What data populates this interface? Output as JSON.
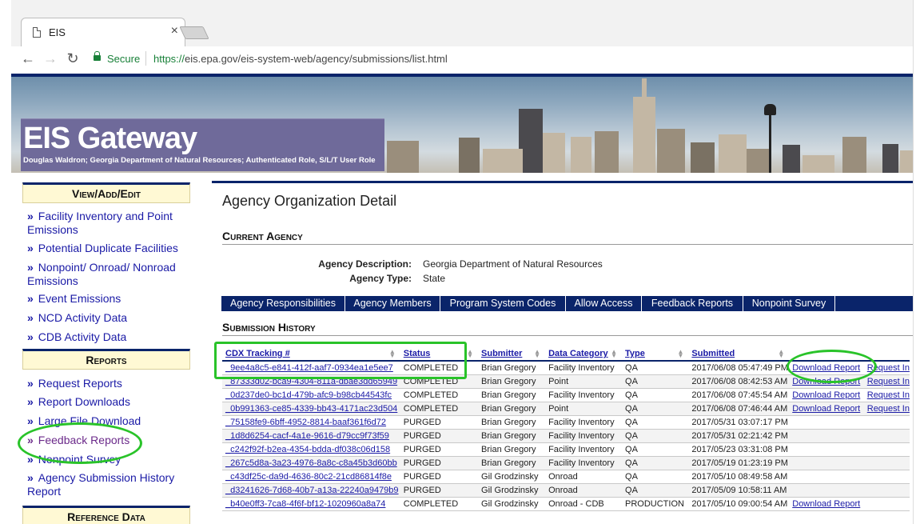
{
  "browser": {
    "tab_title": "EIS",
    "tab_close": "×",
    "secure_label": "Secure",
    "url_scheme": "https://",
    "url_rest": "eis.epa.gov/eis-system-web/agency/submissions/list.html",
    "back": "←",
    "forward": "→",
    "reload": "↻"
  },
  "banner": {
    "title": "EIS Gateway",
    "subtitle": "Douglas Waldron; Georgia Department of Natural Resources; Authenticated Role, S/L/T User Role"
  },
  "sidebar": {
    "view_head": "View/Add/Edit",
    "view_items": [
      {
        "label": "Facility Inventory and Point Emissions"
      },
      {
        "label": "Potential Duplicate Facilities"
      },
      {
        "label": "Nonpoint/ Onroad/ Nonroad Emissions"
      },
      {
        "label": "Event Emissions"
      },
      {
        "label": "NCD Activity Data"
      },
      {
        "label": "CDB Activity Data"
      }
    ],
    "reports_head": "Reports",
    "report_items": [
      {
        "label": "Request Reports"
      },
      {
        "label": "Report Downloads"
      },
      {
        "label": "Large File Download"
      },
      {
        "label": "Feedback Reports"
      },
      {
        "label": "Nonpoint Survey"
      },
      {
        "label": "Agency Submission History Report"
      }
    ],
    "bottom_head": "Reference Data",
    "bullet": "»"
  },
  "main": {
    "title": "Agency Organization Detail",
    "current_agency_head": "Current Agency",
    "agency_description_label": "Agency Description:",
    "agency_description": "Georgia Department of Natural Resources",
    "agency_type_label": "Agency Type:",
    "agency_type": "State",
    "tabs": [
      {
        "label": "Agency Responsibilities"
      },
      {
        "label": "Agency Members"
      },
      {
        "label": "Program System Codes"
      },
      {
        "label": "Allow Access"
      },
      {
        "label": "Feedback Reports"
      },
      {
        "label": "Nonpoint Survey"
      }
    ],
    "submission_head": "Submission History",
    "columns": [
      "CDX Tracking #",
      "Status",
      "Submitter",
      "Data Category",
      "Type",
      "Submitted",
      "",
      ""
    ],
    "rows": [
      [
        "_9ee4a8c5-e841-412f-aaf7-0934ea1e5ee7",
        "COMPLETED",
        "Brian Gregory",
        "Facility Inventory",
        "QA",
        "2017/06/08 05:47:49 PM",
        "Download Report",
        "Request In"
      ],
      [
        "_87333d02-bca9-4304-811a-dbae3dd65949",
        "COMPLETED",
        "Brian Gregory",
        "Point",
        "QA",
        "2017/06/08 08:42:53 AM",
        "Download Report",
        "Request In"
      ],
      [
        "_0d237de0-bc1d-479b-afc9-b98cb44543fc",
        "COMPLETED",
        "Brian Gregory",
        "Facility Inventory",
        "QA",
        "2017/06/08 07:45:54 AM",
        "Download Report",
        "Request In"
      ],
      [
        "_0b991363-ce85-4339-bb43-4171ac23d504",
        "COMPLETED",
        "Brian Gregory",
        "Point",
        "QA",
        "2017/06/08 07:46:44 AM",
        "Download Report",
        "Request In"
      ],
      [
        "_75158fe9-6bff-4952-8814-baaf361f6d72",
        "PURGED",
        "Brian Gregory",
        "Facility Inventory",
        "QA",
        "2017/05/31 03:07:17 PM",
        "",
        ""
      ],
      [
        "_1d8d6254-cacf-4a1e-9616-d79cc9f73f59",
        "PURGED",
        "Brian Gregory",
        "Facility Inventory",
        "QA",
        "2017/05/31 02:21:42 PM",
        "",
        ""
      ],
      [
        "_c242f92f-b2ea-4354-bdda-df038c06d158",
        "PURGED",
        "Brian Gregory",
        "Facility Inventory",
        "QA",
        "2017/05/23 03:31:08 PM",
        "",
        ""
      ],
      [
        "_267c5d8a-3a23-4976-8a8c-c8a45b3d60bb",
        "PURGED",
        "Brian Gregory",
        "Facility Inventory",
        "QA",
        "2017/05/19 01:23:19 PM",
        "",
        ""
      ],
      [
        "_c43df25c-da9d-4636-80c2-21cd86814f8e",
        "PURGED",
        "Gil Grodzinsky",
        "Onroad",
        "QA",
        "2017/05/10 08:49:58 AM",
        "",
        ""
      ],
      [
        "_d3241626-7d68-40b7-a13a-22240a9479b9",
        "PURGED",
        "Gil Grodzinsky",
        "Onroad",
        "QA",
        "2017/05/09 10:58:11 AM",
        "",
        ""
      ],
      [
        "_b40e0ff3-7ca8-4f6f-bf12-1020960a8a74",
        "COMPLETED",
        "Gil Grodzinsky",
        "Onroad - CDB",
        "PRODUCTION",
        "2017/05/10 09:00:54 AM",
        "Download Report",
        ""
      ]
    ]
  },
  "colors": {
    "navy": "#0a246a",
    "link": "#1a1aa6",
    "highlight_green": "#29c329",
    "sidebar_head_bg": "#fff9d4"
  }
}
